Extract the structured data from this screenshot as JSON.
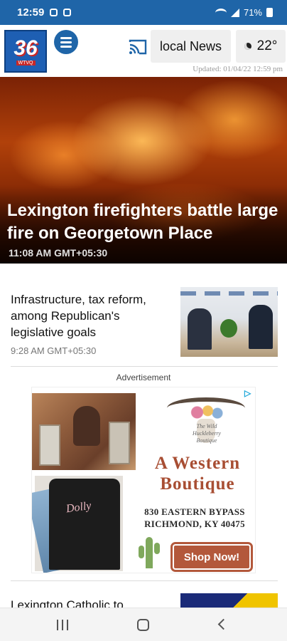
{
  "status_bar": {
    "time": "12:59",
    "battery": "71%"
  },
  "header": {
    "logo_number": "36",
    "logo_call": "WTVQ",
    "local_news_label": "local News",
    "temperature": "22°",
    "updated": "Updated: 01/04/22 12:59 pm"
  },
  "hero": {
    "title": "Lexington firefighters battle large fire on Georgetown Place",
    "time": "11:08 AM GMT+05:30"
  },
  "stories": [
    {
      "title": "Infrastructure, tax reform, among Republican's legislative goals",
      "time": "9:28 AM GMT+05:30"
    },
    {
      "title": "Lexington Catholic to"
    }
  ],
  "ad": {
    "label": "Advertisement",
    "shop_name": "The Wild Huckleberry Boutique",
    "brand": "A Western Boutique",
    "address_line1": "830 EASTERN BYPASS",
    "address_line2": "RICHMOND, KY 40475",
    "button": "Shop Now!",
    "shirt_text": "Dolly"
  },
  "icons": [
    "menu-icon",
    "cast-icon",
    "moon-icon",
    "wifi-icon",
    "signal-icon",
    "battery-icon",
    "adchoices-icon",
    "recent-apps-icon",
    "home-icon",
    "back-icon"
  ],
  "colors": {
    "brand_blue": "#1f65a8",
    "ad_accent": "#b3583b"
  }
}
